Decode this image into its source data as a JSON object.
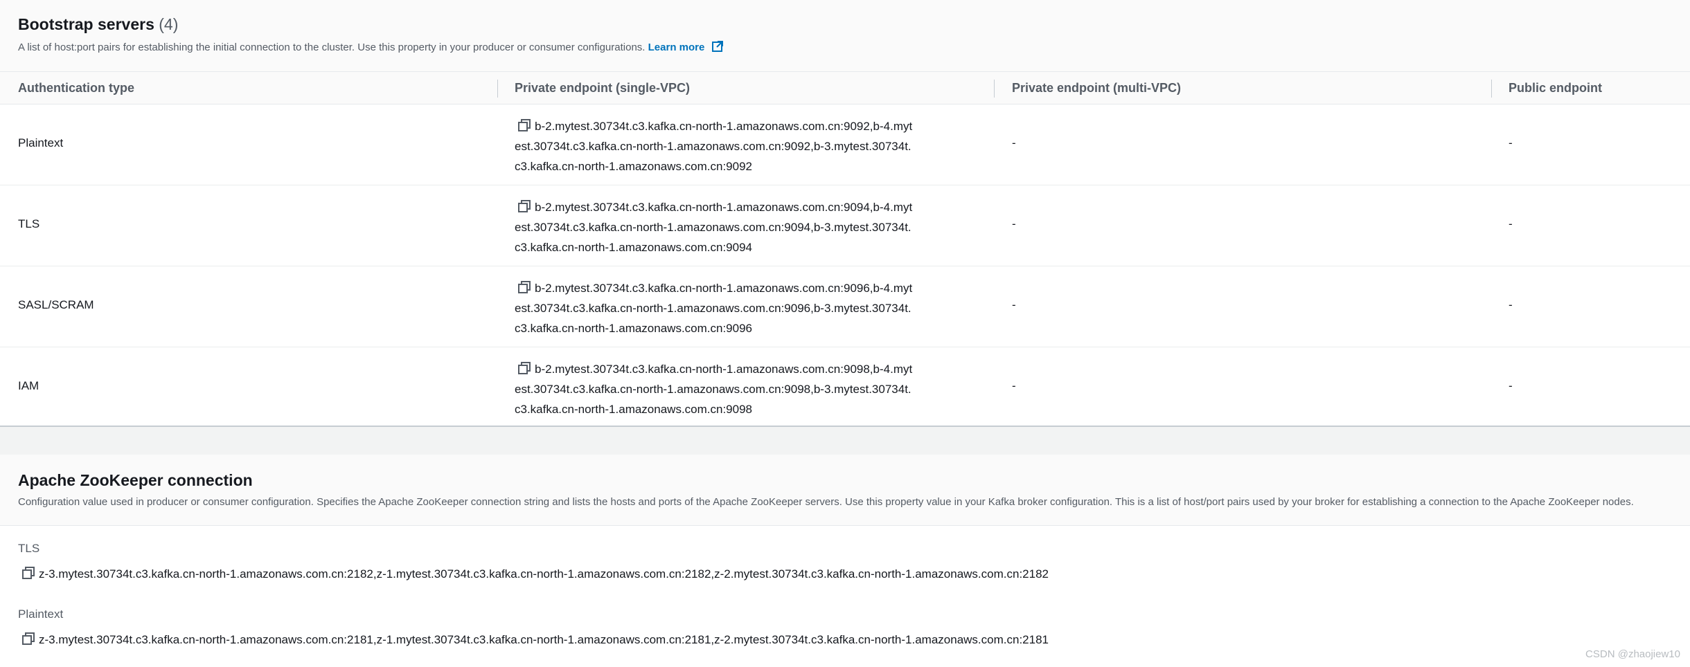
{
  "bootstrap": {
    "title": "Bootstrap servers",
    "count": "(4)",
    "description": "A list of host:port pairs for establishing the initial connection to the cluster. Use this property in your producer or consumer configurations.",
    "learn_more": "Learn more",
    "columns": [
      "Authentication type",
      "Private endpoint (single-VPC)",
      "Private endpoint (multi-VPC)",
      "Public endpoint"
    ],
    "rows": [
      {
        "auth": "Plaintext",
        "private_single": "b-2.mytest.30734t.c3.kafka.cn-north-1.amazonaws.com.cn:9092,b-4.mytest.30734t.c3.kafka.cn-north-1.amazonaws.com.cn:9092,b-3.mytest.30734t.c3.kafka.cn-north-1.amazonaws.com.cn:9092",
        "private_multi": "-",
        "public": "-"
      },
      {
        "auth": "TLS",
        "private_single": "b-2.mytest.30734t.c3.kafka.cn-north-1.amazonaws.com.cn:9094,b-4.mytest.30734t.c3.kafka.cn-north-1.amazonaws.com.cn:9094,b-3.mytest.30734t.c3.kafka.cn-north-1.amazonaws.com.cn:9094",
        "private_multi": "-",
        "public": "-"
      },
      {
        "auth": "SASL/SCRAM",
        "private_single": "b-2.mytest.30734t.c3.kafka.cn-north-1.amazonaws.com.cn:9096,b-4.mytest.30734t.c3.kafka.cn-north-1.amazonaws.com.cn:9096,b-3.mytest.30734t.c3.kafka.cn-north-1.amazonaws.com.cn:9096",
        "private_multi": "-",
        "public": "-"
      },
      {
        "auth": "IAM",
        "private_single": "b-2.mytest.30734t.c3.kafka.cn-north-1.amazonaws.com.cn:9098,b-4.mytest.30734t.c3.kafka.cn-north-1.amazonaws.com.cn:9098,b-3.mytest.30734t.c3.kafka.cn-north-1.amazonaws.com.cn:9098",
        "private_multi": "-",
        "public": "-"
      }
    ]
  },
  "zookeeper": {
    "title": "Apache ZooKeeper connection",
    "description": "Configuration value used in producer or consumer configuration. Specifies the Apache ZooKeeper connection string and lists the hosts and ports of the Apache ZooKeeper servers. Use this property value in your Kafka broker configuration. This is a list of host/port pairs used by your broker for establishing a connection to the Apache ZooKeeper nodes.",
    "entries": [
      {
        "label": "TLS",
        "value": "z-3.mytest.30734t.c3.kafka.cn-north-1.amazonaws.com.cn:2182,z-1.mytest.30734t.c3.kafka.cn-north-1.amazonaws.com.cn:2182,z-2.mytest.30734t.c3.kafka.cn-north-1.amazonaws.com.cn:2182"
      },
      {
        "label": "Plaintext",
        "value": "z-3.mytest.30734t.c3.kafka.cn-north-1.amazonaws.com.cn:2181,z-1.mytest.30734t.c3.kafka.cn-north-1.amazonaws.com.cn:2181,z-2.mytest.30734t.c3.kafka.cn-north-1.amazonaws.com.cn:2181"
      }
    ]
  },
  "watermark": "CSDN @zhaojiew10",
  "icons": {
    "copy": "copy-icon",
    "external_link": "external-link-icon"
  },
  "colors": {
    "link": "#0073bb",
    "text": "#16191f",
    "muted": "#545b64",
    "page_bg": "#f2f3f3"
  }
}
